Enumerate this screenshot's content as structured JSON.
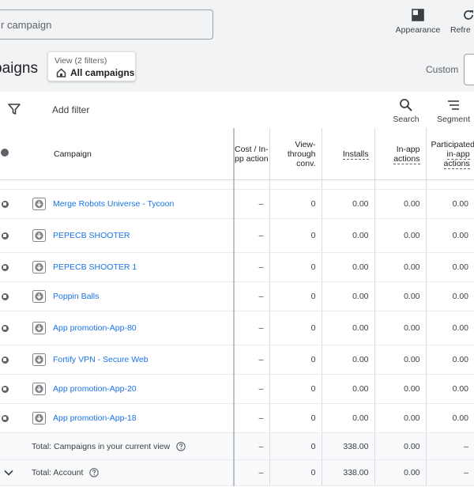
{
  "toolbar": {
    "search_placeholder": "r campaign",
    "appearance_label": "Appearance",
    "refresh_label": "Refre"
  },
  "header": {
    "title": "paigns",
    "view_sub": "View (2 filters)",
    "view_main": "All campaigns",
    "date_range_label": "Custom"
  },
  "filterbar": {
    "add_filter": "Add filter",
    "search_label": "Search",
    "segment_label": "Segment"
  },
  "table": {
    "columns": {
      "campaign": "Campaign",
      "cost_line1": "Cost / In-",
      "cost_line2": "pp action",
      "view_line1": "View-",
      "view_line2": "through",
      "view_line3": "conv.",
      "installs": "Installs",
      "inapp_line1": "In-app",
      "inapp_line2": "actions",
      "part_line1": "Participated",
      "part_line2": "in-app",
      "part_line3": "actions"
    },
    "rows": [
      {
        "name": "Merge Robots Universe - Tycoon",
        "cost": "–",
        "view": "0",
        "installs": "0.00",
        "inapp": "0.00",
        "part": "0.00"
      },
      {
        "name": "PEPECB SHOOTER",
        "cost": "–",
        "view": "0",
        "installs": "0.00",
        "inapp": "0.00",
        "part": "0.00"
      },
      {
        "name": "PEPECB SHOOTER 1",
        "cost": "–",
        "view": "0",
        "installs": "0.00",
        "inapp": "0.00",
        "part": "0.00"
      },
      {
        "name": "Poppin Balls",
        "cost": "–",
        "view": "0",
        "installs": "0.00",
        "inapp": "0.00",
        "part": "0.00"
      },
      {
        "name": "App promotion-App-80",
        "cost": "–",
        "view": "0",
        "installs": "0.00",
        "inapp": "0.00",
        "part": "0.00"
      },
      {
        "name": "Fortify VPN - Secure Web",
        "cost": "–",
        "view": "0",
        "installs": "0.00",
        "inapp": "0.00",
        "part": "0.00"
      },
      {
        "name": "App promotion-App-20",
        "cost": "–",
        "view": "0",
        "installs": "0.00",
        "inapp": "0.00",
        "part": "0.00"
      },
      {
        "name": "App promotion-App-18",
        "cost": "–",
        "view": "0",
        "installs": "0.00",
        "inapp": "0.00",
        "part": "0.00"
      }
    ],
    "totals": [
      {
        "label": "Total: Campaigns in your current view",
        "cost": "–",
        "view": "0",
        "installs": "338.00",
        "inapp": "0.00",
        "part": "–"
      },
      {
        "label": "Total: Account",
        "cost": "–",
        "view": "0",
        "installs": "338.00",
        "inapp": "0.00",
        "part": "–"
      }
    ]
  },
  "colors": {
    "accent": "#1a73e8",
    "topbar_bg": "#f1f3f4",
    "status_paused": "#5f6368"
  }
}
